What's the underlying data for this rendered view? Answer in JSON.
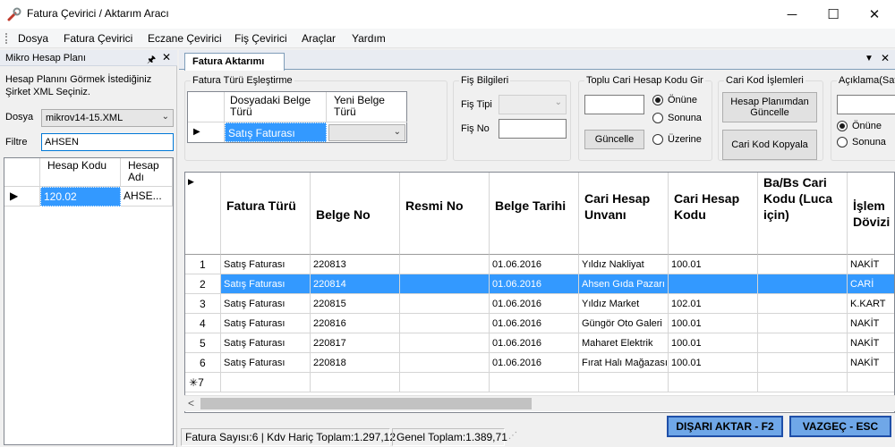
{
  "window": {
    "title": "Fatura Çevirici / Aktarım Aracı"
  },
  "menu": [
    "Dosya",
    "Fatura Çevirici",
    "Eczane Çevirici",
    "Fiş Çevirici",
    "Araçlar",
    "Yardım"
  ],
  "left_panel": {
    "title": "Mikro Hesap Planı",
    "pin_glyph": "📌",
    "info": "Hesap Planını Görmek İstediğiniz Şirket XML Seçiniz.",
    "dosya_label": "Dosya",
    "dosya_value": "mikrov14-15.XML",
    "filtre_label": "Filtre",
    "filtre_value": "AHSEN",
    "grid": {
      "headers": [
        "Hesap Kodu",
        "Hesap Adı"
      ],
      "rows": [
        [
          "120.02",
          "AHSE..."
        ]
      ]
    }
  },
  "document": {
    "tab_label": "Fatura Aktarımı",
    "mapping": {
      "title": "Fatura Türü Eşleştirme",
      "headers": [
        "Dosyadaki Belge Türü",
        "Yeni Belge Türü"
      ],
      "row": {
        "dosyadaki": "Satış Faturası",
        "yeni": ""
      }
    },
    "fis": {
      "title": "Fiş Bilgileri",
      "tipi_label": "Fiş Tipi",
      "tipi_value": "",
      "no_label": "Fiş No",
      "no_value": ""
    },
    "toplu": {
      "title": "Toplu Cari Hesap Kodu Gir",
      "input_value": "",
      "button": "Güncelle",
      "radios": [
        {
          "label": "Önüne",
          "checked": true
        },
        {
          "label": "Sonuna",
          "checked": false
        },
        {
          "label": "Üzerine",
          "checked": false
        }
      ]
    },
    "cari_kod": {
      "title": "Cari Kod İşlemleri",
      "button1": "Hesap Planımdan Güncelle",
      "button2": "Cari Kod Kopyala"
    },
    "aciklama": {
      "title": "Açıklama(Satı",
      "input_value": "",
      "radios": [
        {
          "label": "Önüne",
          "checked": true
        },
        {
          "label": "Sonuna",
          "checked": false
        }
      ]
    },
    "grid": {
      "headers": [
        "Fatura Türü",
        "Belge No",
        "Resmi No",
        "Belge Tarihi",
        "Cari Hesap Unvanı",
        "Cari Hesap Kodu",
        "Ba/Bs Cari Kodu (Luca için)",
        "İşlem Dövizi"
      ],
      "rows": [
        {
          "n": "1",
          "cells": [
            "Satış Faturası",
            "220813",
            "",
            "01.06.2016",
            "Yıldız Nakliyat",
            "100.01",
            "",
            "NAKİT"
          ]
        },
        {
          "n": "2",
          "cells": [
            "Satış Faturası",
            "220814",
            "",
            "01.06.2016",
            "Ahsen Gıda Pazarı",
            "",
            "",
            "CARİ"
          ],
          "selected": true
        },
        {
          "n": "3",
          "cells": [
            "Satış Faturası",
            "220815",
            "",
            "01.06.2016",
            "Yıldız Market",
            "102.01",
            "",
            "K.KART"
          ]
        },
        {
          "n": "4",
          "cells": [
            "Satış Faturası",
            "220816",
            "",
            "01.06.2016",
            "Güngör Oto Galeri",
            "100.01",
            "",
            "NAKİT"
          ]
        },
        {
          "n": "5",
          "cells": [
            "Satış Faturası",
            "220817",
            "",
            "01.06.2016",
            "Maharet Elektrik",
            "100.01",
            "",
            "NAKİT"
          ]
        },
        {
          "n": "6",
          "cells": [
            "Satış Faturası",
            "220818",
            "",
            "01.06.2016",
            "Fırat Halı Mağazası",
            "100.01",
            "",
            "NAKİT"
          ]
        }
      ],
      "new_row_label": "7"
    },
    "status": {
      "summary": "Fatura Sayısı:6 | Kdv Hariç Toplam:1.297,12",
      "total": "Genel Toplam:1.389,71"
    },
    "buttons": {
      "export": "DIŞARI AKTAR - F2",
      "cancel": "VAZGEÇ - ESC"
    }
  },
  "colors": {
    "selection": "#3399ff",
    "action_button": "#6fa7e8",
    "action_border": "#1f4fa8"
  }
}
